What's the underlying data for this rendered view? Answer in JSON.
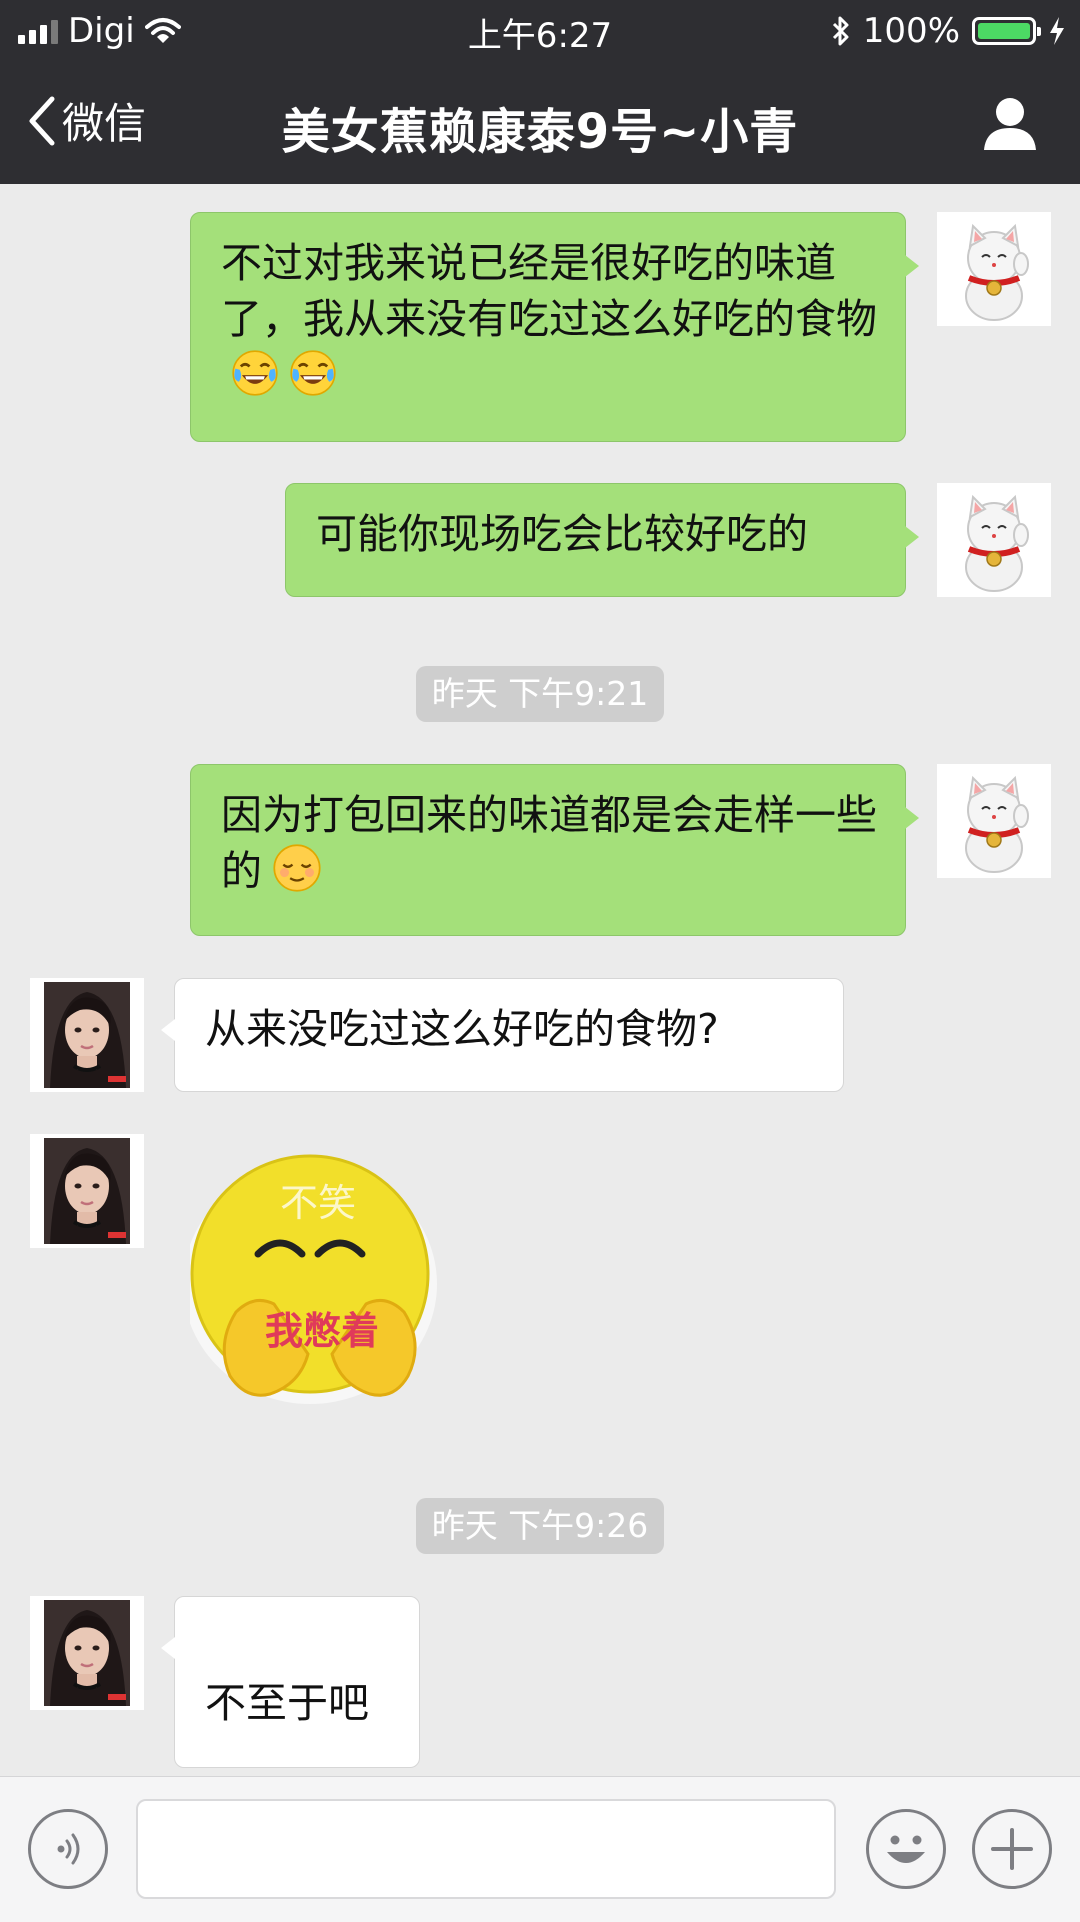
{
  "status_bar": {
    "carrier": "Digi",
    "time": "上午6:27",
    "battery_percent": "100%",
    "battery_level": 1.0,
    "icons": [
      "signal-icon",
      "wifi-icon",
      "bluetooth-icon",
      "battery-icon",
      "charging-icon"
    ]
  },
  "nav": {
    "back_label": "微信",
    "title": "美女蕉赖康泰9号~小青",
    "right_icon": "person-icon"
  },
  "messages": [
    {
      "sender": "me",
      "text": "不过对我来说已经是很好吃的味道了，我从来没有吃过这么好吃的食物",
      "emojis": [
        "face-with-tears-of-joy",
        "face-with-tears-of-joy"
      ]
    },
    {
      "sender": "me",
      "text": "可能你现场吃会比较好吃的"
    },
    {
      "type": "timestamp",
      "text": "昨天 下午9:21"
    },
    {
      "sender": "me",
      "text": "因为打包回来的味道都是会走样一些的",
      "emojis": [
        "relieved-face"
      ]
    },
    {
      "sender": "them",
      "text": "从来没吃过这么好吃的食物?"
    },
    {
      "sender": "them",
      "type": "sticker",
      "sticker_text_top": "不笑",
      "sticker_text_bottom": "我憋着"
    },
    {
      "type": "timestamp",
      "text": "昨天 下午9:26"
    },
    {
      "sender": "them",
      "text": "不至于吧"
    }
  ],
  "avatars": {
    "me": "lucky-cat-avatar",
    "them": "woman-avatar"
  },
  "input_bar": {
    "input_value": "",
    "left_icon": "voice-icon",
    "emoji_icon": "smiley-icon",
    "add_icon": "plus-icon"
  },
  "colors": {
    "nav_bg": "#2e2e32",
    "my_bubble": "#a4e07a",
    "their_bubble": "#ffffff",
    "chat_bg": "#ebebeb"
  }
}
